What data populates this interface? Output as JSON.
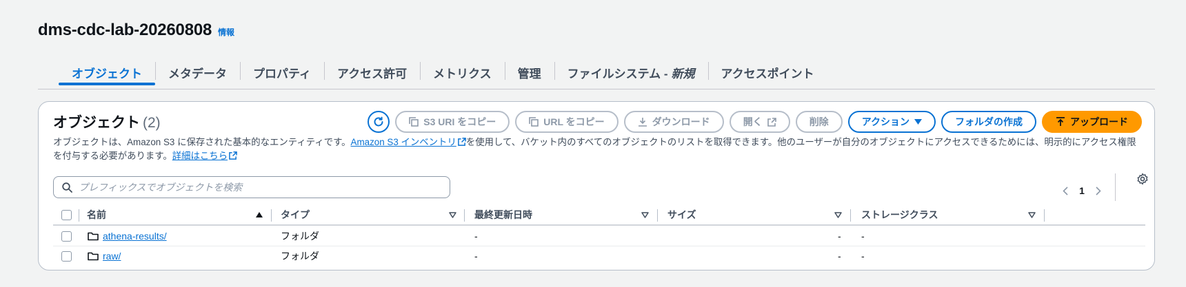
{
  "bucket": {
    "name": "dms-cdc-lab-20260808",
    "info": "情報"
  },
  "tabs": [
    {
      "label": "オブジェクト"
    },
    {
      "label": "メタデータ"
    },
    {
      "label": "プロパティ"
    },
    {
      "label": "アクセス許可"
    },
    {
      "label": "メトリクス"
    },
    {
      "label": "管理"
    },
    {
      "label": "ファイルシステム -",
      "badge": "新規"
    },
    {
      "label": "アクセスポイント"
    }
  ],
  "objects": {
    "title": "オブジェクト",
    "count": "(2)",
    "description_1": "オブジェクトは、Amazon S3 に保存された基本的なエンティティです。",
    "inventory_link": "Amazon S3 インベントリ",
    "description_2": "を使用して、バケット内のすべてのオブジェクトのリストを取得できます。他のユーザーが自分のオブジェクトにアクセスできるためには、明示的にアクセス権限を付与する必要があります。",
    "details_link": "詳細はこちら"
  },
  "toolbar": {
    "copy_s3_uri": "S3 URI をコピー",
    "copy_url": "URL をコピー",
    "download": "ダウンロード",
    "open": "開く",
    "delete": "削除",
    "actions": "アクション",
    "create_folder": "フォルダの作成",
    "upload": "アップロード"
  },
  "search": {
    "placeholder": "プレフィックスでオブジェクトを検索",
    "value": ""
  },
  "pagination": {
    "page": "1"
  },
  "table": {
    "columns": [
      "名前",
      "タイプ",
      "最終更新日時",
      "サイズ",
      "ストレージクラス"
    ],
    "rows": [
      {
        "name": "athena-results/",
        "type": "フォルダ",
        "modified": "-",
        "size": "-",
        "storage": "-"
      },
      {
        "name": "raw/",
        "type": "フォルダ",
        "modified": "-",
        "size": "-",
        "storage": "-"
      }
    ]
  },
  "colors": {
    "accent": "#0972d3",
    "primary_button": "#ff9900",
    "background": "#f2f3f3"
  },
  "icons": [
    "info-link",
    "refresh-icon",
    "copy-icon",
    "download-icon",
    "external-link-icon",
    "caret-down-icon",
    "upload-icon",
    "search-icon",
    "chevron-left-icon",
    "chevron-right-icon",
    "settings-icon",
    "sort-icon",
    "folder-icon"
  ]
}
